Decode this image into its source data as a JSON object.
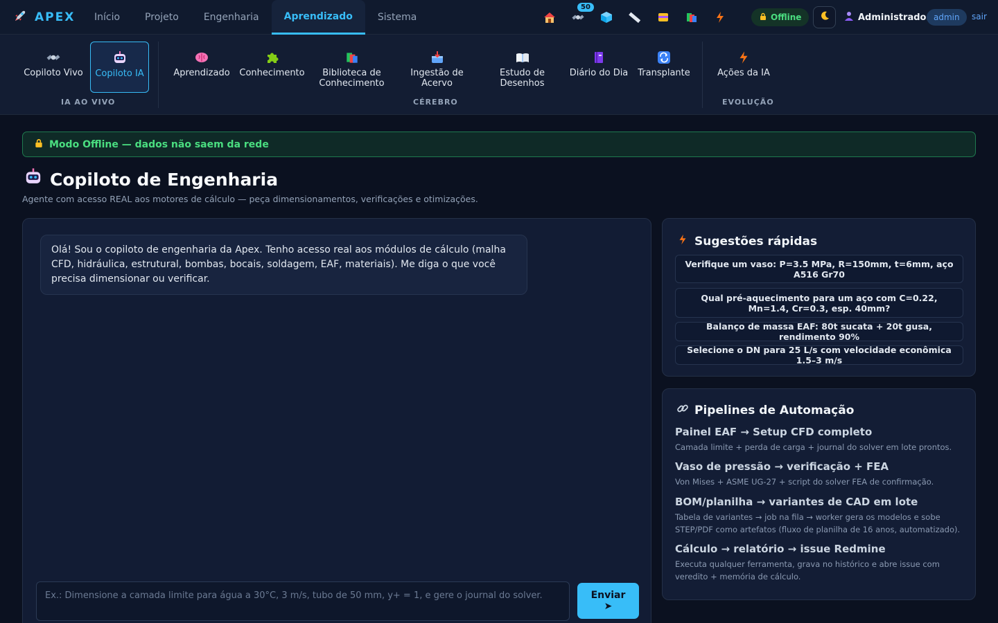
{
  "app": {
    "brand": "APEX"
  },
  "nav": {
    "items": [
      {
        "label": "Início",
        "active": false
      },
      {
        "label": "Projeto",
        "active": false
      },
      {
        "label": "Engenharia",
        "active": false
      },
      {
        "label": "Aprendizado",
        "active": true
      },
      {
        "label": "Sistema",
        "active": false
      }
    ]
  },
  "top_icons": {
    "items": [
      "house-icon",
      "satellite-icon",
      "cube-icon",
      "ruler-icon",
      "card-box-icon",
      "books-icon",
      "bolt-icon"
    ],
    "satellite_badge": "50"
  },
  "status": {
    "offline_label": "Offline"
  },
  "user": {
    "name": "Administrador",
    "role": "admin",
    "logout": "sair"
  },
  "subnav": {
    "groups": [
      {
        "label": "IA AO VIVO"
      },
      {
        "label": "CÉREBRO"
      },
      {
        "label": "EVOLUÇÃO"
      }
    ],
    "items": [
      {
        "label": "Copiloto Vivo",
        "icon": "satellite-icon"
      },
      {
        "label": "Copiloto IA",
        "icon": "robot-icon",
        "active": true
      },
      {
        "label": "Aprendizado",
        "icon": "brain-icon"
      },
      {
        "label": "Conhecimento",
        "icon": "puzzle-icon"
      },
      {
        "label": "Biblioteca de Conhecimento",
        "icon": "books-icon"
      },
      {
        "label": "Ingestão de Acervo",
        "icon": "inbox-icon"
      },
      {
        "label": "Estudo de Desenhos",
        "icon": "open-book-icon"
      },
      {
        "label": "Diário do Dia",
        "icon": "notebook-icon"
      },
      {
        "label": "Transplante",
        "icon": "repeat-icon"
      },
      {
        "label": "Ações da IA",
        "icon": "bolt-icon"
      }
    ]
  },
  "banner": {
    "text": "Modo Offline — dados não saem da rede"
  },
  "page": {
    "title": "Copiloto de Engenharia",
    "subtitle": "Agente com acesso REAL aos motores de cálculo — peça dimensionamentos, verificações e otimizações."
  },
  "chat": {
    "greeting": "Olá! Sou o copiloto de engenharia da Apex. Tenho acesso real aos módulos de cálculo (malha CFD, hidráulica, estrutural, bombas, bocais, soldagem, EAF, materiais). Me diga o que você precisa dimensionar ou verificar.",
    "placeholder": "Ex.: Dimensione a camada limite para água a 30°C, 3 m/s, tubo de 50 mm, y+ = 1, e gere o journal do solver.",
    "send_label": "Enviar",
    "send_icon": "➤"
  },
  "suggestions": {
    "title": "Sugestões rápidas",
    "items": [
      "Verifique um vaso: P=3.5 MPa, R=150mm, t=6mm, aço A516 Gr70",
      "Qual pré-aquecimento para um aço com C=0.22, Mn=1.4, Cr=0.3, esp. 40mm?",
      "Balanço de massa EAF: 80t sucata + 20t gusa, rendimento 90%",
      "Selecione o DN para 25 L/s com velocidade econômica 1.5–3 m/s"
    ]
  },
  "pipelines": {
    "title": "Pipelines de Automação",
    "items": [
      {
        "title": "Painel EAF → Setup CFD completo",
        "desc": "Camada limite + perda de carga + journal do solver em lote prontos."
      },
      {
        "title": "Vaso de pressão → verificação + FEA",
        "desc": "Von Mises + ASME UG-27 + script do solver FEA de confirmação."
      },
      {
        "title": "BOM/planilha → variantes de CAD em lote",
        "desc": "Tabela de variantes → job na fila → worker gera os modelos e sobe STEP/PDF como artefatos (fluxo de planilha de 16 anos, automatizado)."
      },
      {
        "title": "Cálculo → relatório → issue Redmine",
        "desc": "Executa qualquer ferramenta, grava no histórico e abre issue com veredito + memória de cálculo."
      }
    ]
  },
  "colors": {
    "accent": "#38bdf8",
    "background": "#0b1120",
    "success": "#4ade80"
  }
}
